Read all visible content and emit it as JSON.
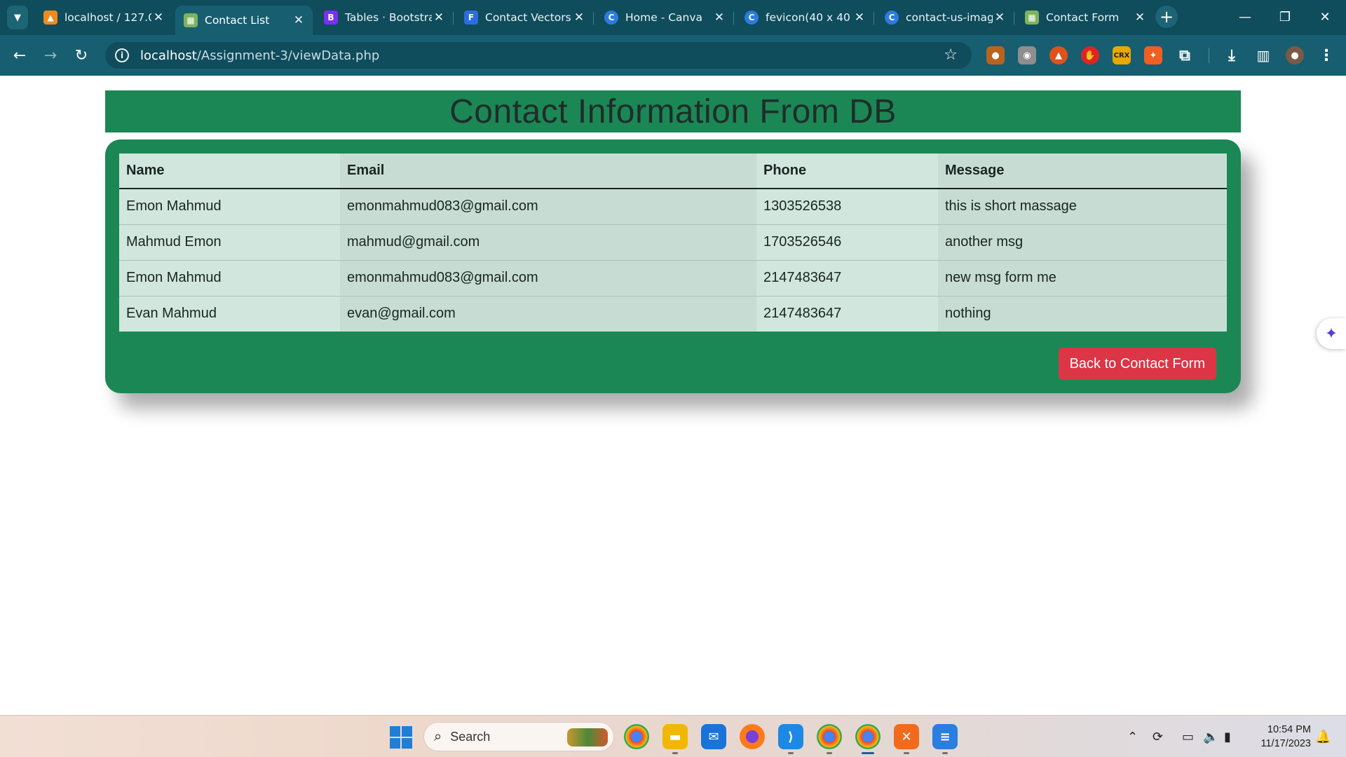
{
  "browser": {
    "tabs": [
      {
        "title": "localhost / 127.0.",
        "favicon_color": "#f08a1c",
        "favicon_glyph": "▲"
      },
      {
        "title": "Contact List",
        "favicon_color": "#7fb25e",
        "favicon_glyph": "▦"
      },
      {
        "title": "Tables · Bootstrap",
        "favicon_color": "#7a2ff2",
        "favicon_glyph": "B"
      },
      {
        "title": "Contact Vectors,",
        "favicon_color": "#2b6de0",
        "favicon_glyph": "F"
      },
      {
        "title": "Home - Canva",
        "favicon_color": "#2c7be0",
        "favicon_glyph": "C"
      },
      {
        "title": "fevicon(40 x 40 p",
        "favicon_color": "#2c7be0",
        "favicon_glyph": "C"
      },
      {
        "title": "contact-us-imag",
        "favicon_color": "#2c7be0",
        "favicon_glyph": "C"
      },
      {
        "title": "Contact Form",
        "favicon_color": "#7fb25e",
        "favicon_glyph": "▦"
      }
    ],
    "active_tab_index": 1,
    "url_host": "localhost",
    "url_path": "/Assignment-3/viewData.php"
  },
  "page": {
    "heading": "Contact Information From DB",
    "table": {
      "headers": [
        "Name",
        "Email",
        "Phone",
        "Message"
      ],
      "rows": [
        [
          "Emon Mahmud",
          "emonmahmud083@gmail.com",
          "1303526538",
          "this is short massage"
        ],
        [
          "Mahmud Emon",
          "mahmud@gmail.com",
          "1703526546",
          "another msg"
        ],
        [
          "Emon Mahmud",
          "emonmahmud083@gmail.com",
          "2147483647",
          "new msg form me"
        ],
        [
          "Evan Mahmud",
          "evan@gmail.com",
          "2147483647",
          "nothing"
        ]
      ]
    },
    "back_button_label": "Back to Contact Form",
    "colors": {
      "header_bg": "#1b8755",
      "card_bg": "#1b8755",
      "button_bg": "#dc3545"
    }
  },
  "taskbar": {
    "search_placeholder": "Search",
    "time": "10:54 PM",
    "date": "11/17/2023"
  }
}
